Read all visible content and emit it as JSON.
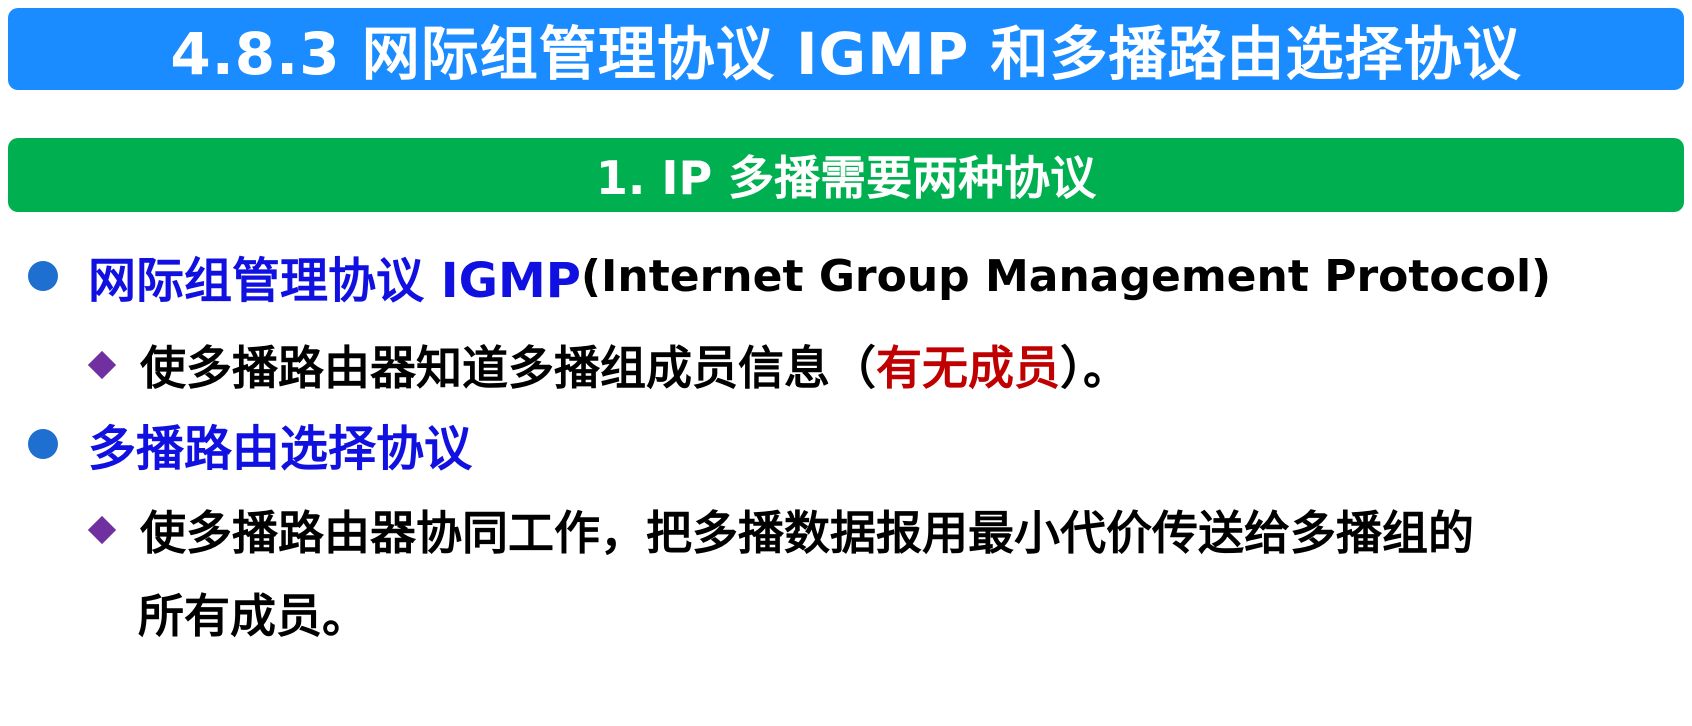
{
  "colors": {
    "title_bg": "#1a8cff",
    "section_bg": "#00b050",
    "bullet_blue": "#1e6fcf",
    "term_blue": "#1010e0",
    "diamond_purple": "#7030a0",
    "highlight_red": "#c00000",
    "body_text": "#000000"
  },
  "slide": {
    "title": "4.8.3  网际组管理协议 IGMP 和多播路由选择协议",
    "section": "1.  IP 多播需要两种协议",
    "items": [
      {
        "bullet_icon": "circle-bullet-icon",
        "term": "网际组管理协议 IGMP",
        "rest": " (Internet Group Management Protocol)",
        "sub": {
          "bullet_icon": "diamond-bullet-icon",
          "prefix": "使多播路由器知道多播组成员信息（",
          "highlight": "有无成员",
          "suffix": "）。"
        }
      },
      {
        "bullet_icon": "circle-bullet-icon",
        "term": "多播路由选择协议",
        "sub": {
          "bullet_icon": "diamond-bullet-icon",
          "line1": "使多播路由器协同工作，把多播数据报用最小代价传送给多播组的",
          "line2": "所有成员。"
        }
      }
    ]
  }
}
